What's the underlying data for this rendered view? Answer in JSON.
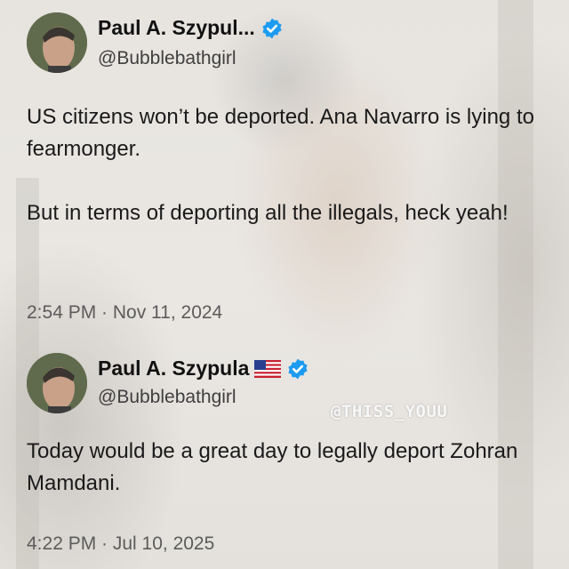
{
  "tweets": [
    {
      "display_name": "Paul A. Szypul...",
      "handle": "@Bubblebathgirl",
      "verified": true,
      "has_flag": false,
      "paragraphs": [
        "US citizens won’t be deported. Ana Navarro is lying to fearmonger.",
        "But in terms of deporting all the illegals, heck yeah!"
      ],
      "timestamp": "2:54 PM · Nov 11, 2024"
    },
    {
      "display_name": "Paul A. Szypula",
      "handle": "@Bubblebathgirl",
      "verified": true,
      "has_flag": true,
      "paragraphs": [
        "Today would be a great day to legally deport Zohran Mamdani."
      ],
      "timestamp": "4:22 PM · Jul 10, 2025"
    }
  ],
  "watermark": "@THISS_YOUU",
  "colors": {
    "verified_badge": "#1d9bf0",
    "text": "#1a1a1a",
    "muted": "#5c5c5c"
  },
  "icons": {
    "verified": "verified-badge-icon",
    "flag": "us-flag-icon"
  }
}
